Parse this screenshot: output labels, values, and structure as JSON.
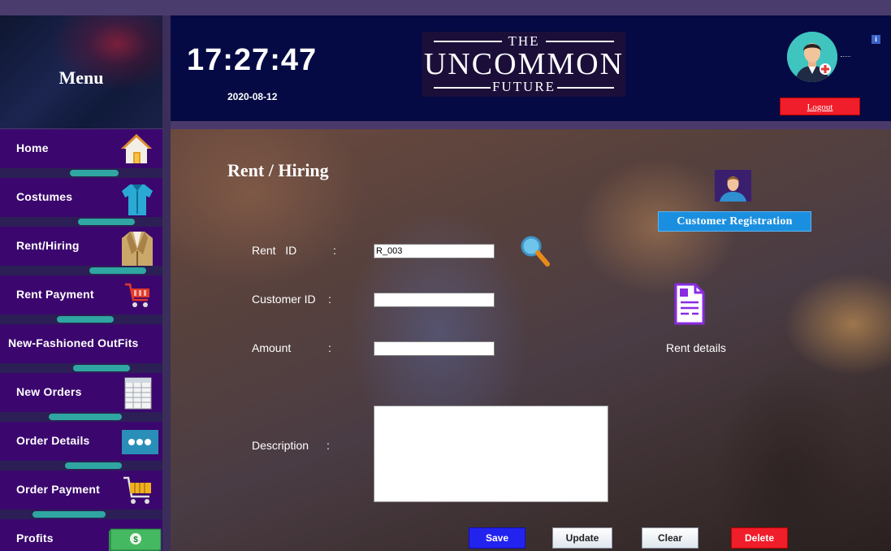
{
  "sidebar": {
    "title": "Menu",
    "items": [
      {
        "label": "Home"
      },
      {
        "label": "Costumes"
      },
      {
        "label": "Rent/Hiring"
      },
      {
        "label": "Rent Payment"
      },
      {
        "label": "New-Fashioned OutFits"
      },
      {
        "label": "New Orders"
      },
      {
        "label": "Order Details"
      },
      {
        "label": "Order Payment"
      },
      {
        "label": "Profits"
      }
    ]
  },
  "header": {
    "time": "17:27:47",
    "date": "2020-08-12",
    "logo": {
      "top": "THE",
      "main": "UNCOMMON",
      "bottom": "FUTURE"
    },
    "info_glyph": "i",
    "logout_label": "Logout"
  },
  "main": {
    "title": "Rent / Hiring",
    "fields": {
      "rent_id": {
        "label": "Rent   ID",
        "value": "R_003"
      },
      "customer_id": {
        "label": "Customer ID",
        "value": ""
      },
      "amount": {
        "label": "Amount",
        "value": ""
      },
      "description": {
        "label": "Description",
        "value": ""
      }
    },
    "colon": ":",
    "customer_registration_label": "Customer  Registration",
    "rent_details_label": "Rent details",
    "buttons": {
      "save": "Save",
      "update": "Update",
      "clear": "Clear",
      "delete": "Delete"
    }
  },
  "icons": {
    "home": "home-icon",
    "costumes": "shirt-icon",
    "rent_hiring": "blazer-icon",
    "rent_payment": "shopping-cart-icon",
    "new_orders": "spreadsheet-icon",
    "order_details": "more-dots-icon",
    "order_payment": "shopping-cart-icon",
    "profits": "cash-icon",
    "search": "search-icon",
    "customer": "user-avatar-icon",
    "rent_details": "document-icon"
  },
  "colors": {
    "sidebar_item": "#3b076e",
    "header_bg": "#050a44",
    "save": "#2323f0",
    "delete": "#f01e2a",
    "customer_registration": "#1a8fe0"
  }
}
